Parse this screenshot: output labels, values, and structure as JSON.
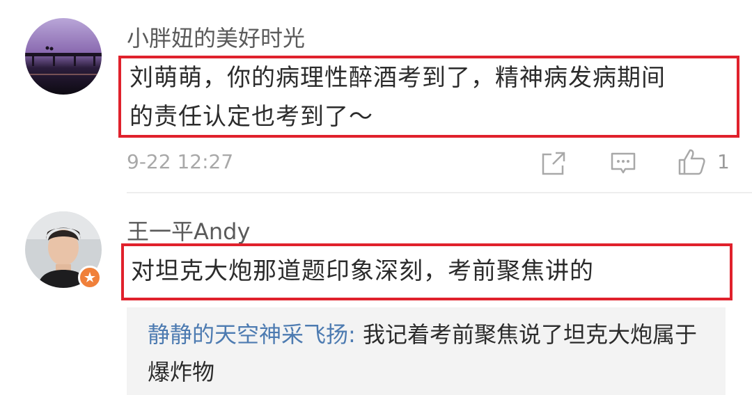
{
  "comments": [
    {
      "username": "小胖妞的美好时光",
      "text_line1": "刘萌萌，你的病理性醉酒考到了，精神病发病期间",
      "text_line2": "的责任认定也考到了～",
      "timestamp": "9-22 12:27",
      "like_count": "1",
      "avatar_icon": "avatar-sunset-bridge"
    },
    {
      "username": "王一平Andy",
      "text": "对坦克大炮那道题印象深刻，考前聚焦讲的",
      "avatar_icon": "avatar-young-man-photo",
      "badge_icon": "verified-star-badge",
      "reply": {
        "author": "静静的天空神采飞扬",
        "separator": ":",
        "text": " 我记着考前聚焦说了坦克大炮属于爆炸物"
      }
    }
  ],
  "colors": {
    "highlight_border": "#e0212c",
    "reply_author": "#4d7bb1",
    "badge": "#f0803a"
  }
}
